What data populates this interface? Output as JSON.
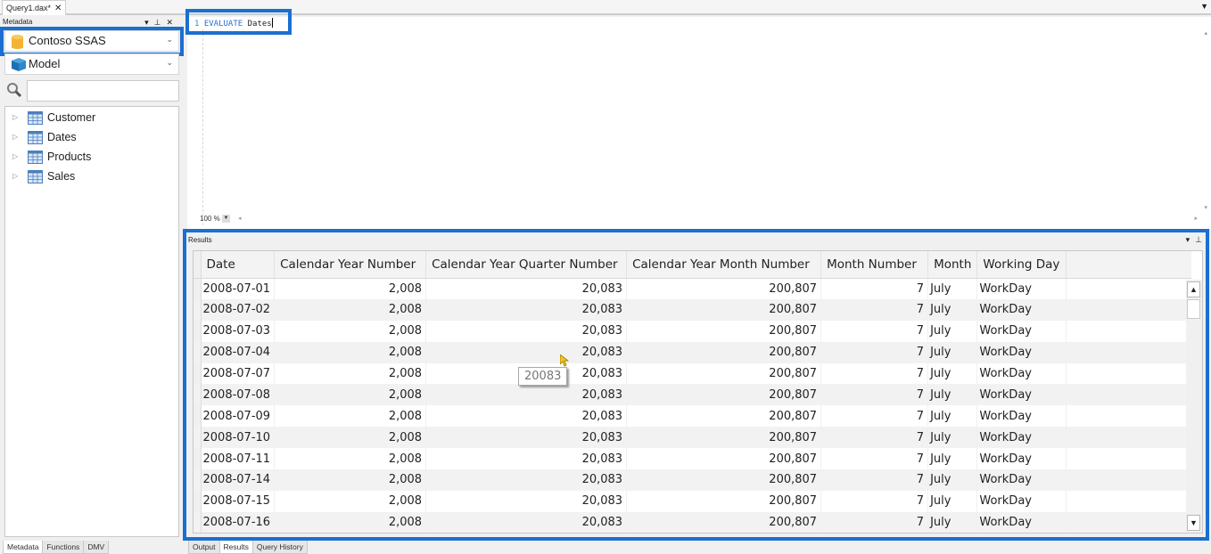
{
  "document_tab": {
    "title": "Query1.dax*",
    "close": "✕"
  },
  "window": {
    "overflow_icon": "▼"
  },
  "metadata": {
    "title": "Metadata",
    "pane_buttons": [
      "▾",
      "⊥",
      "✕"
    ],
    "server": "Contoso SSAS",
    "model": "Model",
    "search_placeholder": "",
    "tables": [
      {
        "name": "Customer"
      },
      {
        "name": "Dates"
      },
      {
        "name": "Products"
      },
      {
        "name": "Sales"
      }
    ],
    "tabs": [
      {
        "label": "Metadata",
        "active": true
      },
      {
        "label": "Functions",
        "active": false
      },
      {
        "label": "DMV",
        "active": false
      }
    ]
  },
  "editor": {
    "line_number": "1",
    "keyword": "EVALUATE",
    "argument": "Dates",
    "zoom": "100 %"
  },
  "results": {
    "title": "Results",
    "pane_buttons": [
      "▾",
      "⊥"
    ],
    "columns": [
      "Date",
      "Calendar Year Number",
      "Calendar Year Quarter Number",
      "Calendar Year Month Number",
      "Month Number",
      "Month",
      "Working Day"
    ],
    "rows": [
      [
        "2008-07-01",
        "2,008",
        "20,083",
        "200,807",
        "7",
        "July",
        "WorkDay"
      ],
      [
        "2008-07-02",
        "2,008",
        "20,083",
        "200,807",
        "7",
        "July",
        "WorkDay"
      ],
      [
        "2008-07-03",
        "2,008",
        "20,083",
        "200,807",
        "7",
        "July",
        "WorkDay"
      ],
      [
        "2008-07-04",
        "2,008",
        "20,083",
        "200,807",
        "7",
        "July",
        "WorkDay"
      ],
      [
        "2008-07-07",
        "2,008",
        "20,083",
        "200,807",
        "7",
        "July",
        "WorkDay"
      ],
      [
        "2008-07-08",
        "2,008",
        "20,083",
        "200,807",
        "7",
        "July",
        "WorkDay"
      ],
      [
        "2008-07-09",
        "2,008",
        "20,083",
        "200,807",
        "7",
        "July",
        "WorkDay"
      ],
      [
        "2008-07-10",
        "2,008",
        "20,083",
        "200,807",
        "7",
        "July",
        "WorkDay"
      ],
      [
        "2008-07-11",
        "2,008",
        "20,083",
        "200,807",
        "7",
        "July",
        "WorkDay"
      ],
      [
        "2008-07-14",
        "2,008",
        "20,083",
        "200,807",
        "7",
        "July",
        "WorkDay"
      ],
      [
        "2008-07-15",
        "2,008",
        "20,083",
        "200,807",
        "7",
        "July",
        "WorkDay"
      ],
      [
        "2008-07-16",
        "2,008",
        "20,083",
        "200,807",
        "7",
        "July",
        "WorkDay"
      ]
    ],
    "tooltip": "20083",
    "tabs": [
      {
        "label": "Output",
        "active": false
      },
      {
        "label": "Results",
        "active": true
      },
      {
        "label": "Query History",
        "active": false
      }
    ]
  },
  "colors": {
    "highlight": "#1a6fd1",
    "keyword": "#2b6ed1"
  }
}
